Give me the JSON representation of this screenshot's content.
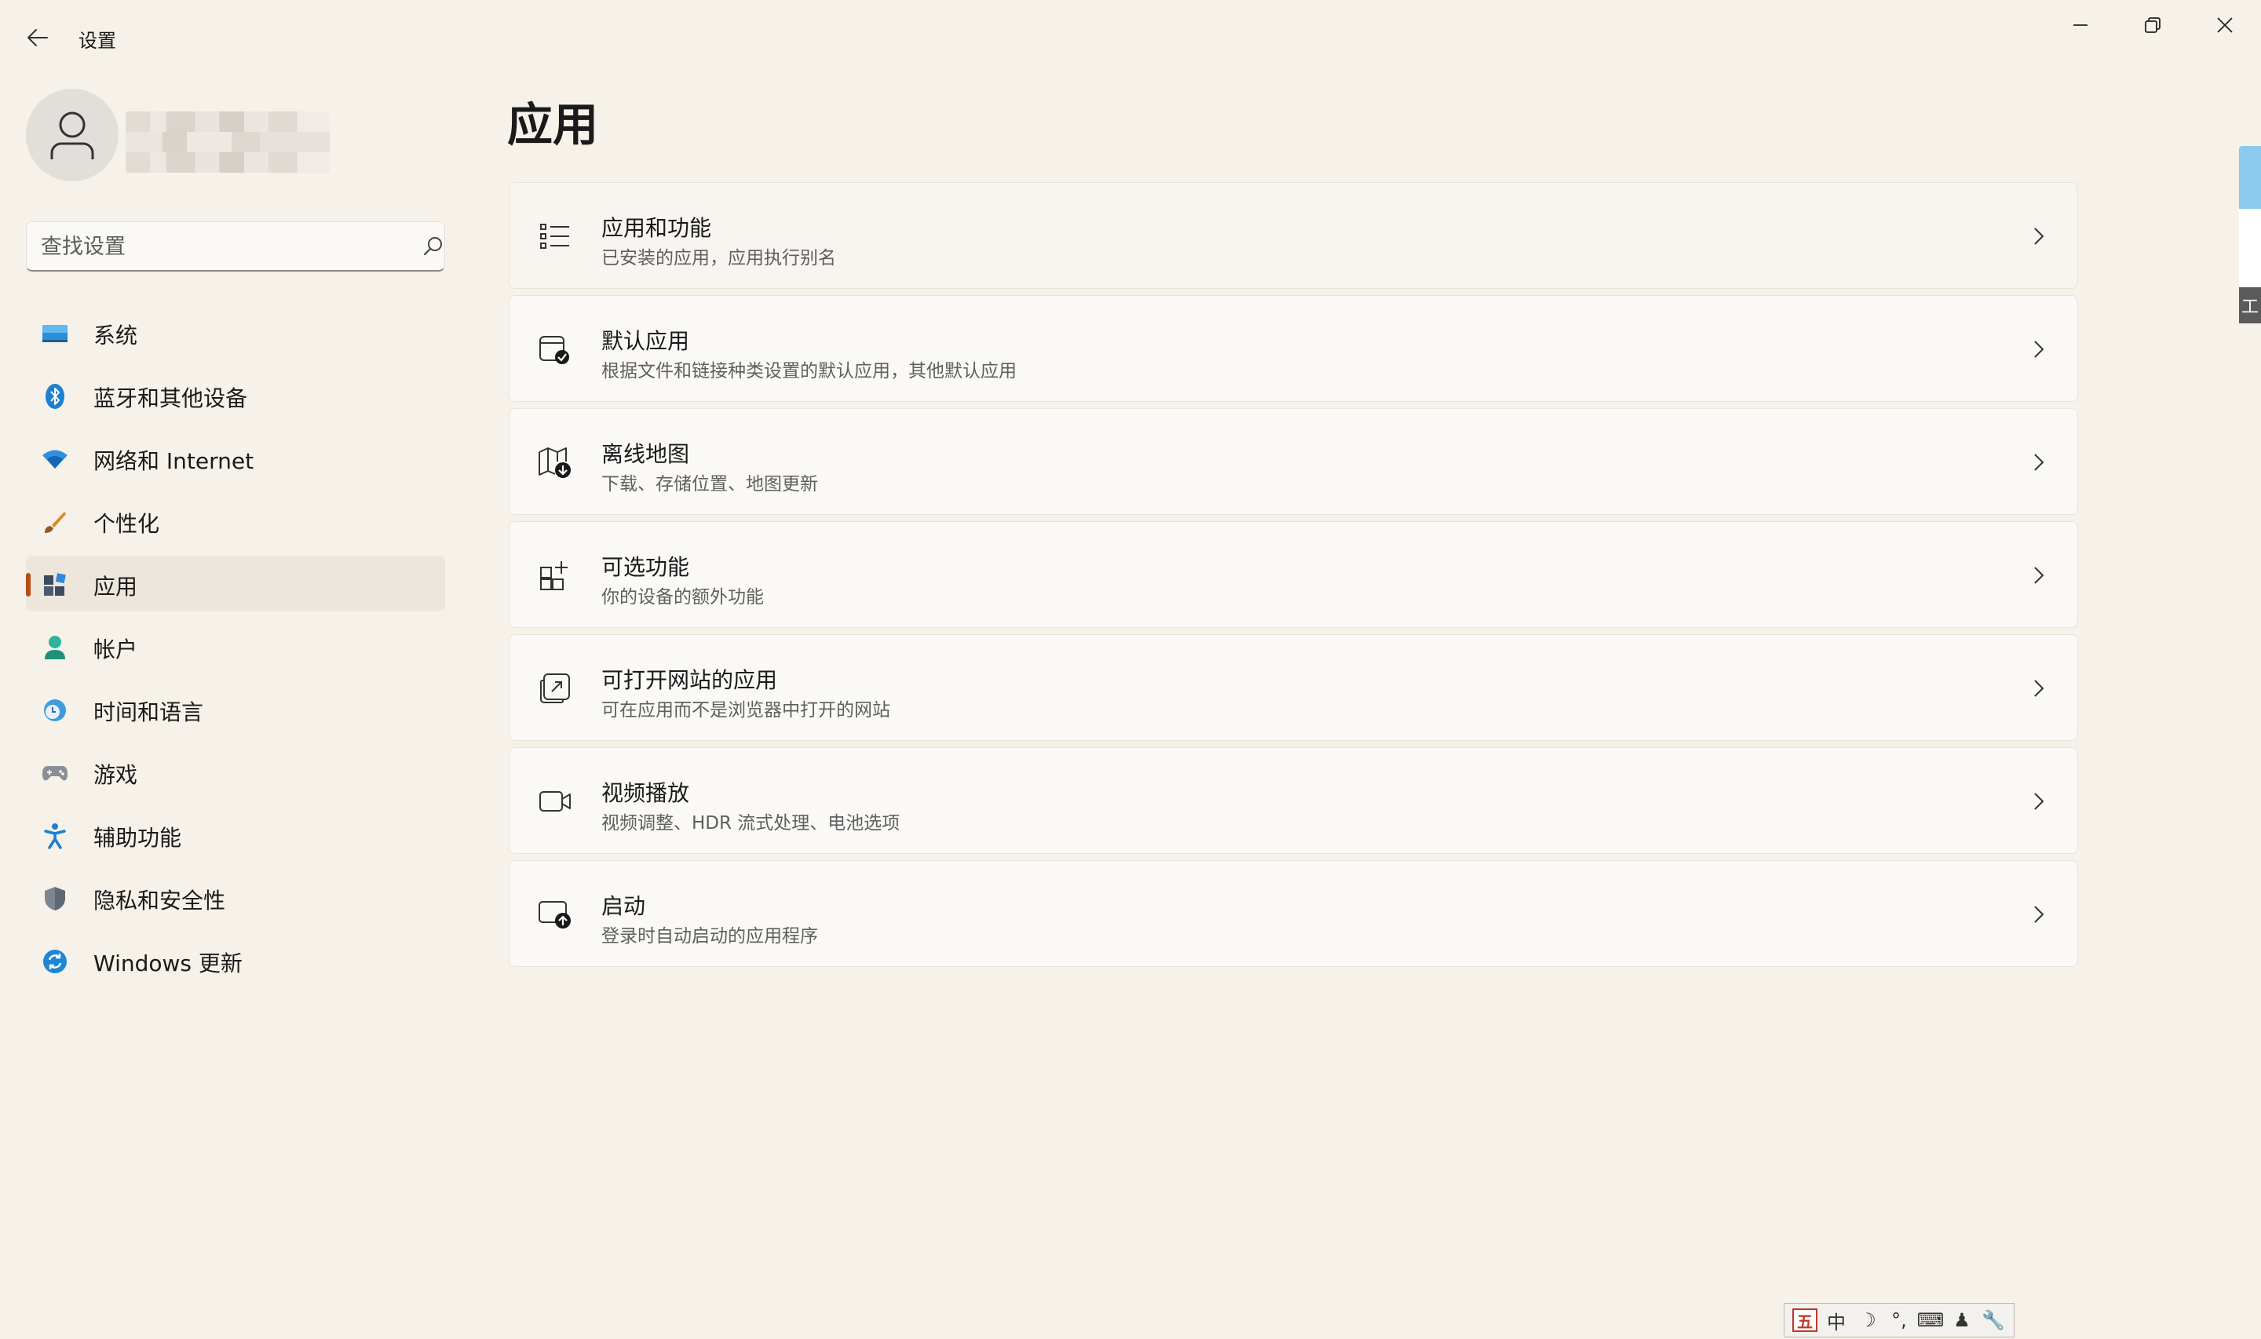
{
  "window": {
    "title": "设置",
    "controls": [
      "minimize",
      "restore",
      "close"
    ]
  },
  "profile": {
    "avatar_icon": "person-icon",
    "name": ""
  },
  "search": {
    "placeholder": "查找设置",
    "icon": "search-icon"
  },
  "sidebar": {
    "selected": "应用",
    "accent_color": "#b84d16",
    "items": [
      {
        "label": "系统",
        "icon": "system-monitor-icon"
      },
      {
        "label": "蓝牙和其他设备",
        "icon": "bluetooth-icon"
      },
      {
        "label": "网络和 Internet",
        "icon": "wifi-icon"
      },
      {
        "label": "个性化",
        "icon": "paintbrush-icon"
      },
      {
        "label": "应用",
        "icon": "apps-icon"
      },
      {
        "label": "帐户",
        "icon": "account-icon"
      },
      {
        "label": "时间和语言",
        "icon": "globe-clock-icon"
      },
      {
        "label": "游戏",
        "icon": "gamepad-icon"
      },
      {
        "label": "辅助功能",
        "icon": "accessibility-icon"
      },
      {
        "label": "隐私和安全性",
        "icon": "shield-icon"
      },
      {
        "label": "Windows 更新",
        "icon": "update-icon"
      }
    ]
  },
  "main": {
    "title": "应用",
    "cards": [
      {
        "title": "应用和功能",
        "subtitle": "已安装的应用，应用执行别名",
        "icon": "list-icon"
      },
      {
        "title": "默认应用",
        "subtitle": "根据文件和链接种类设置的默认应用，其他默认应用",
        "icon": "default-apps-icon"
      },
      {
        "title": "离线地图",
        "subtitle": "下载、存储位置、地图更新",
        "icon": "map-download-icon"
      },
      {
        "title": "可选功能",
        "subtitle": "你的设备的额外功能",
        "icon": "add-feature-icon"
      },
      {
        "title": "可打开网站的应用",
        "subtitle": "可在应用而不是浏览器中打开的网站",
        "icon": "open-external-icon"
      },
      {
        "title": "视频播放",
        "subtitle": "视频调整、HDR 流式处理、电池选项",
        "icon": "video-camera-icon"
      },
      {
        "title": "启动",
        "subtitle": "登录时自动启动的应用程序",
        "icon": "startup-icon"
      }
    ]
  },
  "edge_widget": {
    "label": "工"
  },
  "ime_toolbar": {
    "items": [
      "五",
      "中",
      "☽",
      "°,",
      "⌨",
      "♟",
      "🔧"
    ]
  }
}
